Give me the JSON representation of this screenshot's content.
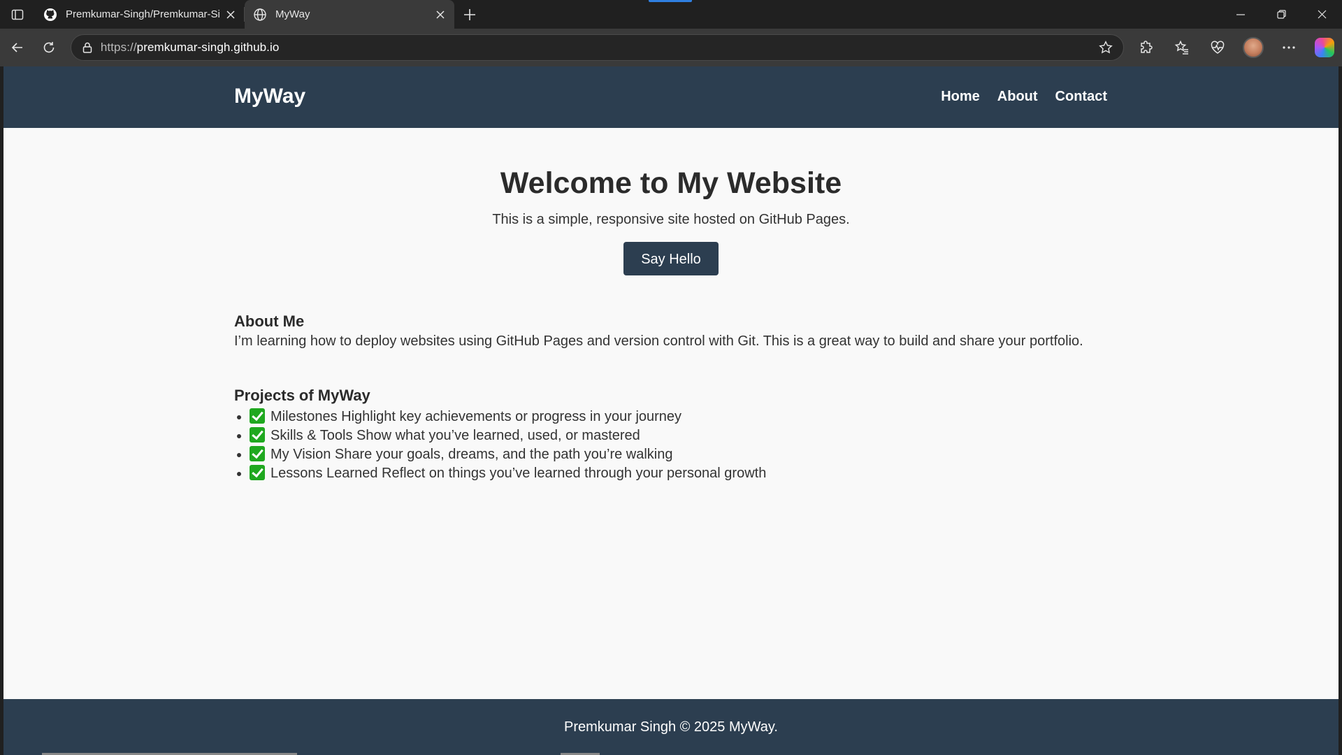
{
  "browser": {
    "tabs": [
      {
        "title": "Premkumar-Singh/Premkumar-Si",
        "icon": "github-icon",
        "active": false
      },
      {
        "title": "MyWay",
        "icon": "globe-icon",
        "active": true
      }
    ],
    "url_scheme": "https://",
    "url_host": "premkumar-singh.github.io"
  },
  "site": {
    "brand": "MyWay",
    "nav": [
      "Home",
      "About",
      "Contact"
    ],
    "hero": {
      "title": "Welcome to My Website",
      "subtitle": "This is a simple, responsive site hosted on GitHub Pages.",
      "button": "Say Hello"
    },
    "about": {
      "heading": "About Me",
      "text": "I’m learning how to deploy websites using GitHub Pages and version control with Git. This is a great way to build and share your portfolio."
    },
    "projects": {
      "heading": "Projects of MyWay",
      "items": [
        "Milestones Highlight key achievements or progress in your journey",
        "Skills & Tools Show what you’ve learned, used, or mastered",
        "My Vision Share your goals, dreams, and the path you’re walking",
        "Lessons Learned Reflect on things you’ve learned through your personal growth"
      ]
    },
    "footer": "Premkumar Singh © 2025 MyWay."
  },
  "colors": {
    "header_bg": "#2c3e50",
    "page_bg": "#f9f9f9",
    "check": "#1fa81f"
  }
}
